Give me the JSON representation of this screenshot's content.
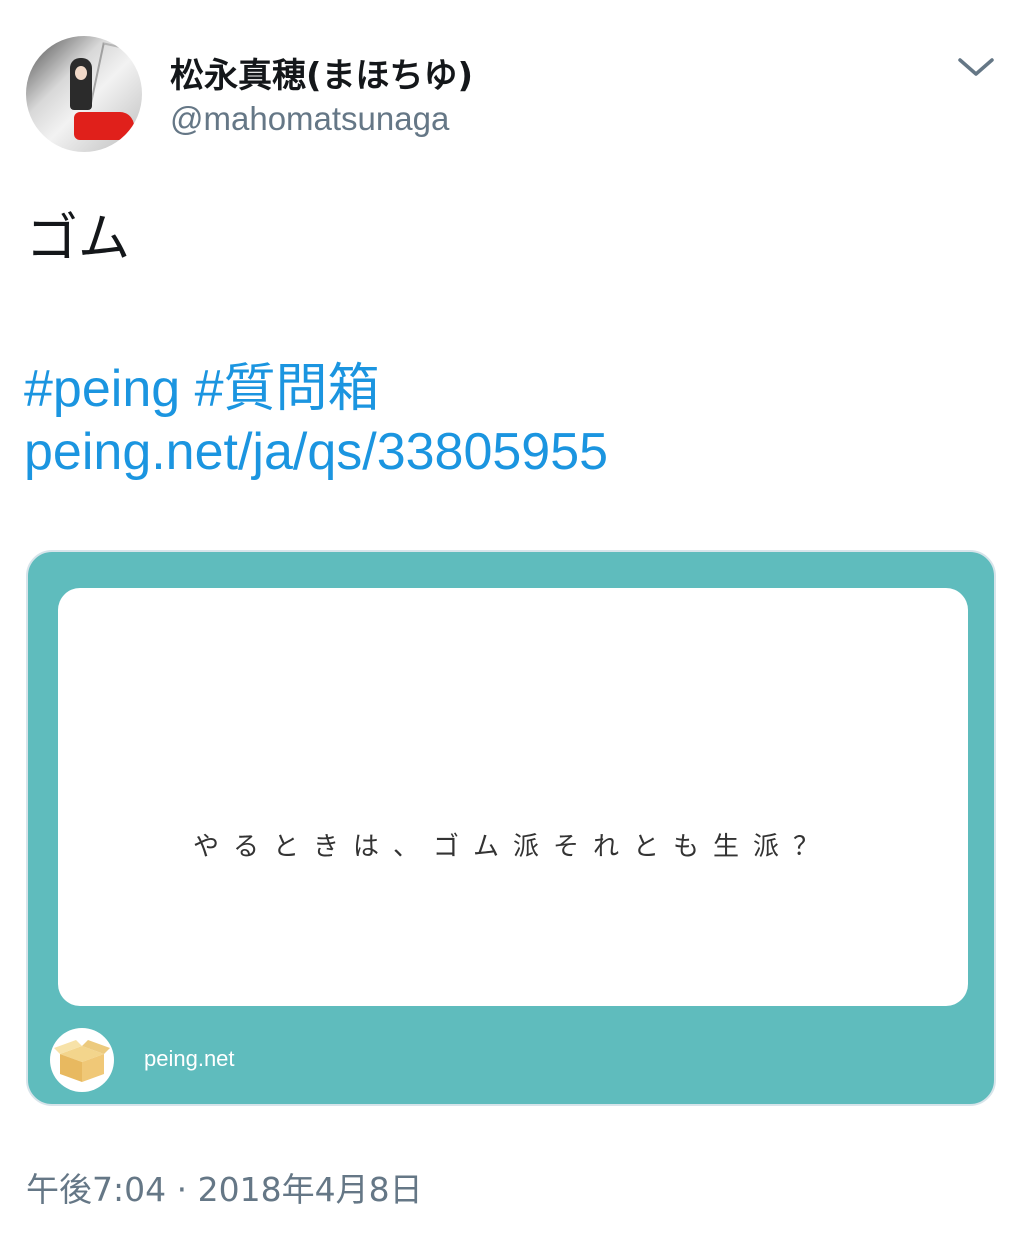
{
  "author": {
    "display_name": "松永真穂(まほちゆ)",
    "handle": "@mahomatsunaga",
    "avatar_icon": "profile-photo"
  },
  "menu": {
    "icon": "chevron-down-icon"
  },
  "tweet": {
    "text": "ゴム",
    "hashtags": [
      "#peing",
      "#質問箱"
    ],
    "link": "peing.net/ja/qs/33805955"
  },
  "card": {
    "question": "やるときは、ゴム派それとも生派？",
    "domain": "peing.net",
    "site_icon": "cardboard-box-icon",
    "background_color": "#5fbcbd"
  },
  "meta": {
    "time": "午後7:04",
    "separator": "·",
    "date": "2018年4月8日"
  },
  "colors": {
    "link": "#1b95e0",
    "text": "#14171a",
    "secondary": "#657786"
  }
}
